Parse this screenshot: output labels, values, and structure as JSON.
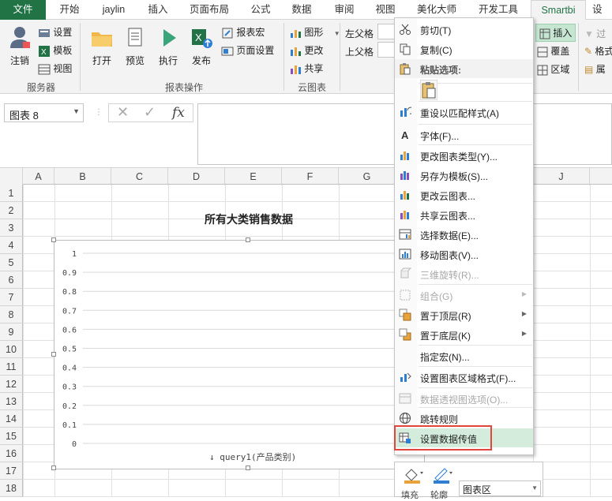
{
  "tabs": [
    {
      "label": "文件"
    },
    {
      "label": "开始"
    },
    {
      "label": "jaylin"
    },
    {
      "label": "插入"
    },
    {
      "label": "页面布局"
    },
    {
      "label": "公式"
    },
    {
      "label": "数据"
    },
    {
      "label": "审阅"
    },
    {
      "label": "视图"
    },
    {
      "label": "美化大师"
    },
    {
      "label": "开发工具"
    },
    {
      "label": "Smartbi"
    },
    {
      "label": "设"
    }
  ],
  "ribbon": {
    "login": "注销",
    "settings": "设置",
    "template": "模板",
    "view": "视图",
    "group_server": "服务器",
    "open": "打开",
    "preview": "预览",
    "execute": "执行",
    "publish": "发布",
    "report_macro": "报表宏",
    "page_setup": "页面设置",
    "group_report": "报表操作",
    "shape": "图形",
    "change": "更改",
    "share": "共享",
    "group_cloud": "云图表",
    "left_parent": "左父格",
    "top_parent": "上父格",
    "insert": "插入",
    "cover": "覆盖",
    "region": "区域",
    "filter": "过",
    "format": "格式",
    "attr": "属"
  },
  "namebox": {
    "value": "图表 8"
  },
  "columns": [
    "A",
    "B",
    "C",
    "D",
    "E",
    "F",
    "G",
    "J"
  ],
  "rows": [
    "1",
    "2",
    "3",
    "4",
    "5",
    "6",
    "7",
    "8",
    "9",
    "10",
    "11",
    "12",
    "13",
    "14",
    "15",
    "16",
    "17",
    "18"
  ],
  "chart": {
    "title": "所有大类销售数据",
    "x_label": "query1(产品类别)",
    "y_ticks": [
      "1",
      "0.9",
      "0.8",
      "0.7",
      "0.6",
      "0.5",
      "0.4",
      "0.3",
      "0.2",
      "0.1",
      "0"
    ]
  },
  "chart_data": {
    "type": "bar",
    "title": "所有大类销售数据",
    "xlabel": "query1(产品类别)",
    "ylabel": "",
    "categories": [],
    "values": [],
    "ylim": [
      0,
      1
    ],
    "grid": true
  },
  "context_menu": {
    "items": [
      {
        "label": "剪切(T)",
        "icon": "scissors-icon",
        "disabled": false
      },
      {
        "label": "复制(C)",
        "icon": "copy-icon",
        "disabled": false
      },
      {
        "label": "粘贴选项:",
        "icon": "paste-icon",
        "disabled": false
      },
      {
        "label": "重设以匹配样式(A)",
        "icon": "reset-style-icon",
        "disabled": false
      },
      {
        "label": "字体(F)...",
        "icon": "font-icon",
        "disabled": false
      },
      {
        "label": "更改图表类型(Y)...",
        "icon": "chart-type-icon",
        "disabled": false
      },
      {
        "label": "另存为模板(S)...",
        "icon": "save-template-icon",
        "disabled": false
      },
      {
        "label": "更改云图表...",
        "icon": "cloud-chart-icon",
        "disabled": false
      },
      {
        "label": "共享云图表...",
        "icon": "share-chart-icon",
        "disabled": false
      },
      {
        "label": "选择数据(E)...",
        "icon": "select-data-icon",
        "disabled": false
      },
      {
        "label": "移动图表(V)...",
        "icon": "move-chart-icon",
        "disabled": false
      },
      {
        "label": "三维旋转(R)...",
        "icon": "rotate-3d-icon",
        "disabled": true
      },
      {
        "label": "组合(G)",
        "icon": "group-icon",
        "disabled": true
      },
      {
        "label": "置于顶层(R)",
        "icon": "bring-front-icon",
        "disabled": false
      },
      {
        "label": "置于底层(K)",
        "icon": "send-back-icon",
        "disabled": false
      },
      {
        "label": "指定宏(N)...",
        "icon": "",
        "disabled": false
      },
      {
        "label": "设置图表区域格式(F)...",
        "icon": "format-area-icon",
        "disabled": false
      },
      {
        "label": "数据透视图选项(O)...",
        "icon": "pivot-icon",
        "disabled": true
      },
      {
        "label": "跳转规则",
        "icon": "globe-icon",
        "disabled": false
      },
      {
        "label": "设置数据传值",
        "icon": "data-transfer-icon",
        "disabled": false
      }
    ]
  },
  "mini_toolbar": {
    "fill": "填充",
    "outline": "轮廓",
    "area": "图表区"
  },
  "colors": {
    "accent": "#217346",
    "highlight": "#d4ecdc",
    "red_box": "#e0463b"
  }
}
